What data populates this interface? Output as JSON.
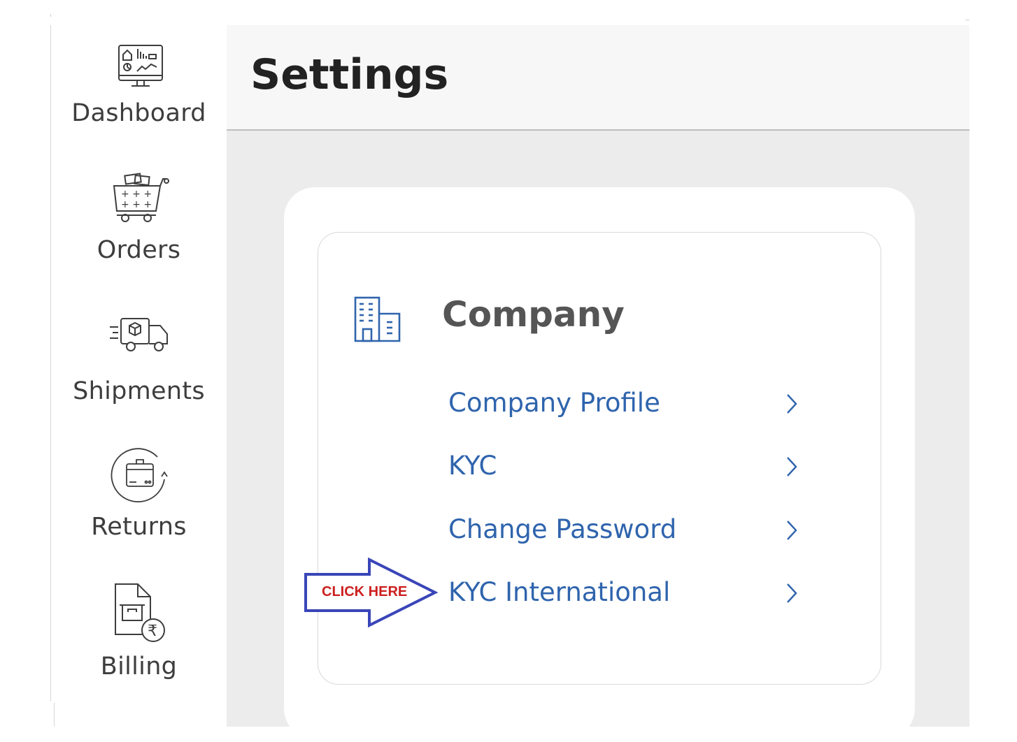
{
  "sidebar": {
    "items": [
      {
        "label": "Dashboard",
        "icon": "dashboard-monitor-icon"
      },
      {
        "label": "Orders",
        "icon": "shopping-cart-icon"
      },
      {
        "label": "Shipments",
        "icon": "delivery-truck-icon"
      },
      {
        "label": "Returns",
        "icon": "return-box-icon"
      },
      {
        "label": "Billing",
        "icon": "invoice-rupee-icon"
      }
    ]
  },
  "header": {
    "title": "Settings"
  },
  "company_section": {
    "title": "Company",
    "icon": "building-icon",
    "links": [
      {
        "label": "Company Profile"
      },
      {
        "label": "KYC"
      },
      {
        "label": "Change Password"
      },
      {
        "label": "KYC International"
      }
    ]
  },
  "annotation": {
    "text": "CLICK HERE"
  },
  "colors": {
    "link": "#2f64ad",
    "annotation_arrow": "#3a45b8",
    "annotation_text": "#cc1f1f",
    "main_bg": "#ececec"
  }
}
